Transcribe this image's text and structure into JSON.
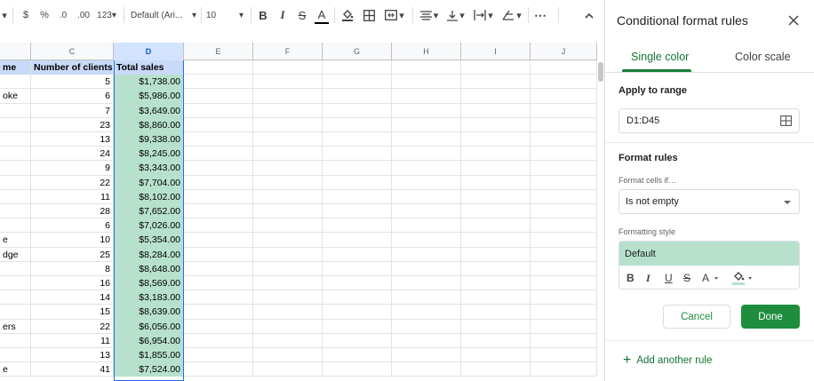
{
  "toolbar": {
    "dropdown_caret": "▾",
    "currency": "$",
    "percent": "%",
    "decrease_decimal": ".0",
    "increase_decimal": ".00",
    "number_format": "123",
    "font": "Default (Ari...",
    "font_size": "10",
    "bold": "B",
    "italic": "I",
    "strikethrough": "S",
    "text_color": "A",
    "more": "⋯"
  },
  "grid": {
    "columns": [
      "C",
      "D",
      "E",
      "F",
      "G",
      "H",
      "I",
      "J"
    ],
    "header_row": {
      "b": "me",
      "c": "Number of clients",
      "d": "Total sales"
    },
    "rows": [
      {
        "b": "",
        "c": "5",
        "d": "$1,738.00"
      },
      {
        "b": "oke",
        "c": "6",
        "d": "$5,986.00"
      },
      {
        "b": "",
        "c": "7",
        "d": "$3,649.00"
      },
      {
        "b": "",
        "c": "23",
        "d": "$8,860.00"
      },
      {
        "b": "",
        "c": "13",
        "d": "$9,338.00"
      },
      {
        "b": "",
        "c": "24",
        "d": "$8,245.00"
      },
      {
        "b": "",
        "c": "9",
        "d": "$3,343.00"
      },
      {
        "b": "",
        "c": "22",
        "d": "$7,704.00"
      },
      {
        "b": "",
        "c": "11",
        "d": "$8,102.00"
      },
      {
        "b": "",
        "c": "28",
        "d": "$7,652.00"
      },
      {
        "b": "",
        "c": "6",
        "d": "$7,026.00"
      },
      {
        "b": "e",
        "c": "10",
        "d": "$5,354.00"
      },
      {
        "b": "dge",
        "c": "25",
        "d": "$8,284.00"
      },
      {
        "b": "",
        "c": "8",
        "d": "$8,648.00"
      },
      {
        "b": "",
        "c": "16",
        "d": "$8,569.00"
      },
      {
        "b": "",
        "c": "14",
        "d": "$3,183.00"
      },
      {
        "b": "",
        "c": "15",
        "d": "$8,639.00"
      },
      {
        "b": "ers",
        "c": "22",
        "d": "$6,056.00"
      },
      {
        "b": "",
        "c": "11",
        "d": "$6,954.00"
      },
      {
        "b": "",
        "c": "13",
        "d": "$1,855.00"
      },
      {
        "b": "e",
        "c": "41",
        "d": "$7,524.00"
      }
    ]
  },
  "panel": {
    "title": "Conditional format rules",
    "tabs": {
      "single": "Single color",
      "scale": "Color scale"
    },
    "apply_label": "Apply to range",
    "range_value": "D1:D45",
    "format_rules_label": "Format rules",
    "format_cells_if_label": "Format cells if…",
    "condition_value": "Is not empty",
    "formatting_style_label": "Formatting style",
    "style_preview": "Default",
    "fmt": {
      "bold": "B",
      "italic": "I",
      "underline": "U",
      "strike": "S",
      "text_color": "A"
    },
    "cancel": "Cancel",
    "done": "Done",
    "add_rule": "Add another rule",
    "add_rule_icon": "+"
  },
  "colors": {
    "accent_green": "#1e8e3e",
    "preview_fill": "#b7e1cd",
    "header_fill": "#c9daf8"
  }
}
